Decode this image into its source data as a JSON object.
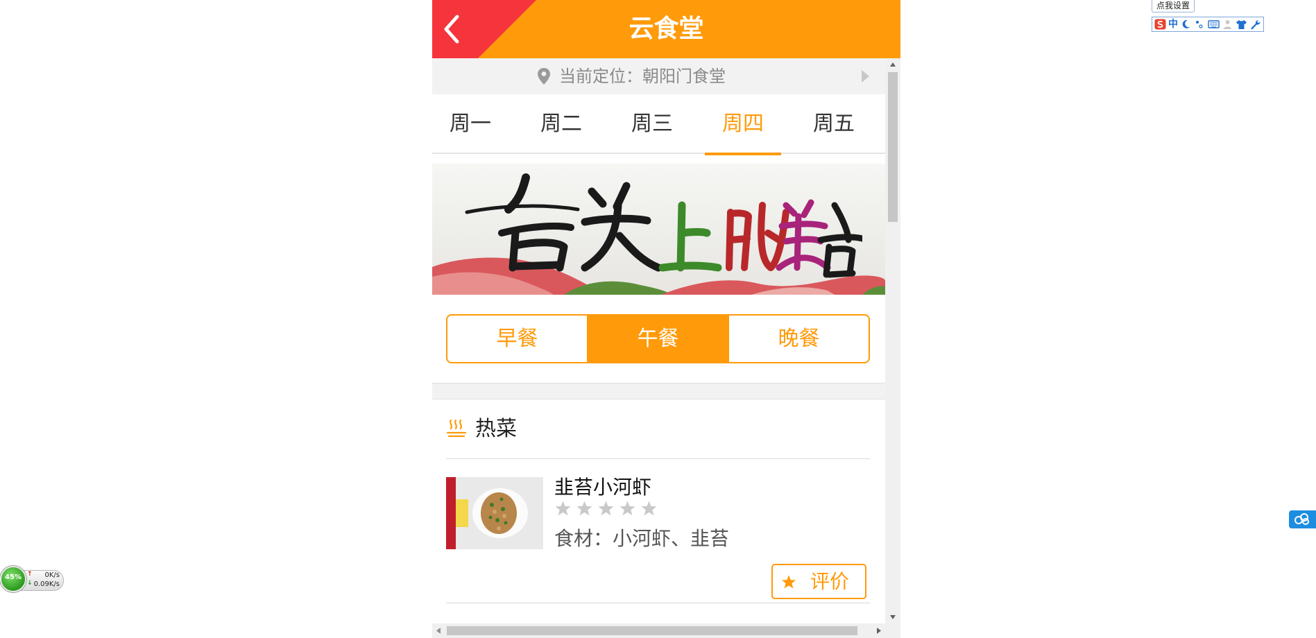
{
  "header": {
    "title": "云食堂"
  },
  "location": {
    "text": "当前定位：朝阳门食堂"
  },
  "days": [
    {
      "label": "周一",
      "active": false
    },
    {
      "label": "周二",
      "active": false
    },
    {
      "label": "周三",
      "active": false
    },
    {
      "label": "周四",
      "active": true
    },
    {
      "label": "周五",
      "active": false
    }
  ],
  "banner": {
    "alt": "舌尖上的美食"
  },
  "meal_tabs": [
    {
      "label": "早餐",
      "active": false
    },
    {
      "label": "午餐",
      "active": true
    },
    {
      "label": "晚餐",
      "active": false
    }
  ],
  "section": {
    "title": "热菜",
    "icon": "steam-icon"
  },
  "dishes": [
    {
      "name": "韭苔小河虾",
      "rating": 0,
      "rating_max": 5,
      "ingredients": "食材：小河虾、韭苔",
      "rate_label": "评价"
    }
  ],
  "colors": {
    "accent": "#ff9a0a",
    "back_red": "#f5343c",
    "location_bg": "#f2f2f2"
  },
  "desktop": {
    "ime_tip": "点我设置",
    "ime_mode": "中",
    "net_percent": "45%",
    "net_up": "0K/s",
    "net_down": "0.09K/s"
  }
}
